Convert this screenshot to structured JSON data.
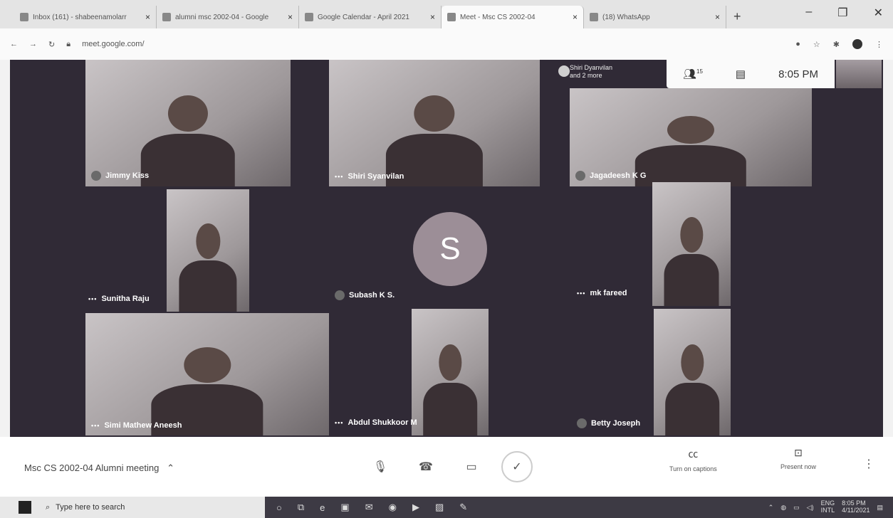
{
  "browser": {
    "tabs": [
      {
        "title": "Inbox (161) - shabeenamolarr",
        "active": false
      },
      {
        "title": "alumni msc 2002-04 - Google",
        "active": false
      },
      {
        "title": "Google Calendar - April 2021",
        "active": false
      },
      {
        "title": "Meet - Msc CS 2002-04",
        "active": true
      },
      {
        "title": "(18) WhatsApp",
        "active": false
      }
    ],
    "url": "meet.google.com/"
  },
  "meet": {
    "info_bar": {
      "people_count": "15",
      "time": "8:05 PM"
    },
    "stacked_label": {
      "line1": "Shiri Dyanvilan",
      "line2": "and 2 more"
    },
    "avatar_letter": "S",
    "participants": [
      {
        "name": "Jimmy Kiss"
      },
      {
        "name": "Shiri Syanvilan"
      },
      {
        "name": "Jagadeesh K G"
      },
      {
        "name": "Sunitha Raju"
      },
      {
        "name": "Subash K S."
      },
      {
        "name": "mk fareed"
      },
      {
        "name": "Simi Mathew Aneesh"
      },
      {
        "name": "Abdul Shukkoor M"
      },
      {
        "name": "Betty Joseph"
      }
    ],
    "meeting_title": "Msc CS 2002-04 Alumni meeting",
    "captions_label": "Turn on captions",
    "present_label": "Present now"
  },
  "taskbar": {
    "search_placeholder": "Type here to search",
    "lang": "ENG",
    "region": "INTL",
    "time": "8:05 PM",
    "date": "4/11/2021"
  }
}
